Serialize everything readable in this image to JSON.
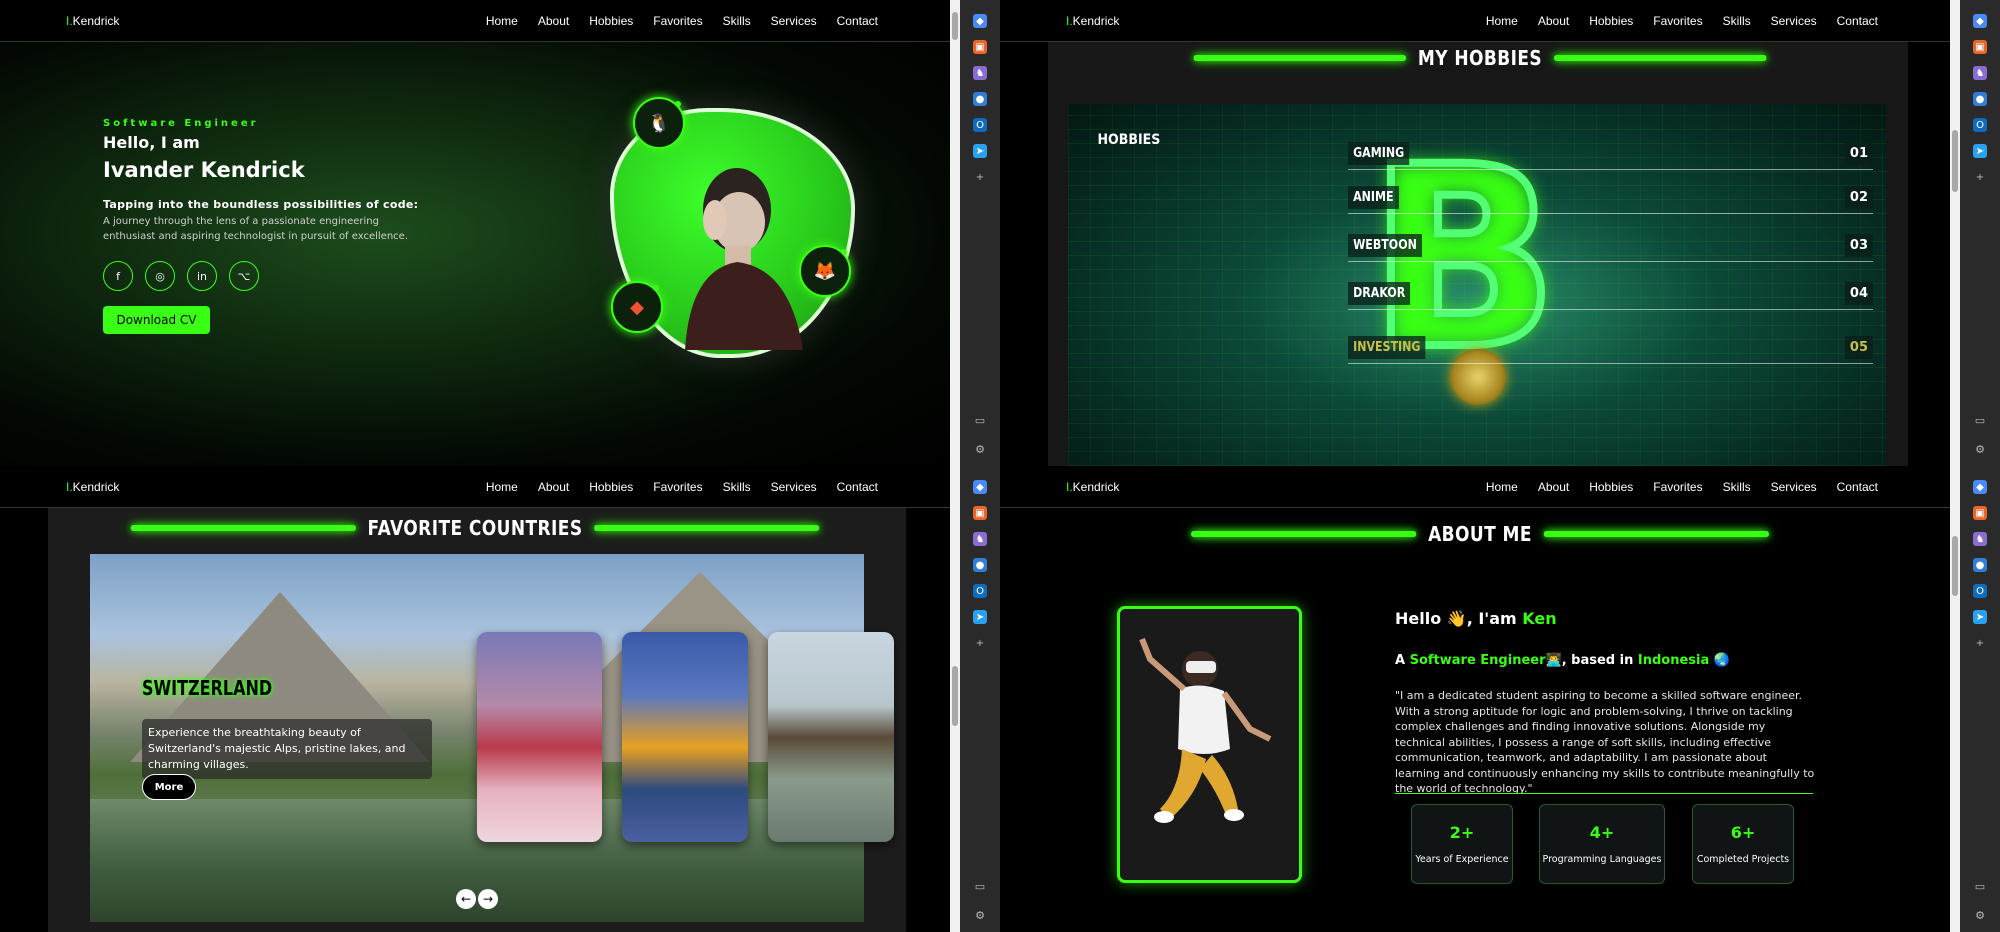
{
  "nav": {
    "logo_prefix": "I.",
    "logo_name": "Kendrick",
    "items": [
      "Home",
      "About",
      "Hobbies",
      "Favorites",
      "Skills",
      "Services",
      "Contact"
    ]
  },
  "hero": {
    "role": "Software Engineer",
    "greeting": "Hello, I am",
    "name": "Ivander Kendrick",
    "headline": "Tapping into the boundless possibilities of code:",
    "description": "A journey through the lens of a passionate engineering enthusiast and aspiring technologist in pursuit of excellence.",
    "socials": [
      "facebook-icon",
      "instagram-icon",
      "linkedin-icon",
      "github-icon"
    ],
    "download_label": "Download CV",
    "badges": [
      "linux-icon",
      "gitlab-icon",
      "git-icon"
    ]
  },
  "hobbies": {
    "section_title": "MY HOBBIES",
    "panel_title": "HOBBIES",
    "items": [
      {
        "label": "GAMING",
        "num": "01"
      },
      {
        "label": "ANIME",
        "num": "02"
      },
      {
        "label": "WEBTOON",
        "num": "03"
      },
      {
        "label": "DRAKOR",
        "num": "04"
      },
      {
        "label": "INVESTING",
        "num": "05"
      }
    ]
  },
  "favorites": {
    "section_title": "FAVORITE COUNTRIES",
    "featured_title": "SWITZERLAND",
    "featured_desc": "Experience the breathtaking beauty of Switzerland's majestic Alps, pristine lakes, and charming villages.",
    "more_label": "More",
    "prev": "←",
    "next": "→"
  },
  "about": {
    "section_title": "ABOUT ME",
    "hello_prefix": "Hello 👋, I'am ",
    "hello_name": "Ken",
    "role_prefix": "A ",
    "role": "Software Engineer",
    "role_emoji": "👨‍💻",
    "based": ", based in ",
    "country": "Indonesia",
    "globe": "🌏",
    "text": "\"I am a dedicated student aspiring to become a skilled software engineer. With a strong aptitude for logic and problem-solving, I thrive on tackling complex challenges and finding innovative solutions. Alongside my technical abilities, I possess a range of soft skills, including effective communication, teamwork, and adaptability. I am passionate about learning and continuously enhancing my skills to contribute meaningfully to the world of technology.\"",
    "stats": [
      {
        "value": "2+",
        "label": "Years of Experience"
      },
      {
        "value": "4+",
        "label": "Programming Languages"
      },
      {
        "value": "6+",
        "label": "Completed Projects"
      }
    ]
  },
  "sidebar_icons": [
    "tag-icon",
    "toolbox-icon",
    "chess-icon",
    "copilot-icon",
    "outlook-icon",
    "send-icon",
    "add-icon"
  ],
  "colors": {
    "accent": "#39ff14",
    "background": "#000000"
  }
}
